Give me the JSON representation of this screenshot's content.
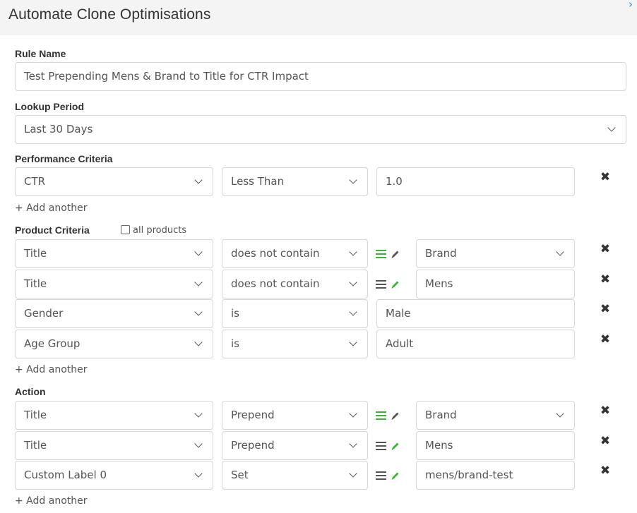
{
  "modal": {
    "title": "Automate Clone Optimisations",
    "close_glyph": "›"
  },
  "rule_name": {
    "label": "Rule Name",
    "value": "Test Prepending Mens & Brand to Title for CTR Impact"
  },
  "lookup_period": {
    "label": "Lookup Period",
    "value": "Last 30 Days"
  },
  "performance": {
    "label": "Performance Criteria",
    "rows": [
      {
        "field": "CTR",
        "operator": "Less Than",
        "value": "1.0"
      }
    ],
    "add_label": "+ Add another"
  },
  "product": {
    "label": "Product Criteria",
    "all_products_label": "all products",
    "rows": [
      {
        "field": "Title",
        "operator": "does not contain",
        "value": "Brand",
        "mode": "list"
      },
      {
        "field": "Title",
        "operator": "does not contain",
        "value": "Mens",
        "mode": "text"
      },
      {
        "field": "Gender",
        "operator": "is",
        "value": "Male"
      },
      {
        "field": "Age Group",
        "operator": "is",
        "value": "Adult"
      }
    ],
    "add_label": "+ Add another"
  },
  "action": {
    "label": "Action",
    "rows": [
      {
        "field": "Title",
        "operator": "Prepend",
        "value": "Brand",
        "mode": "list"
      },
      {
        "field": "Title",
        "operator": "Prepend",
        "value": "Mens",
        "mode": "text"
      },
      {
        "field": "Custom Label 0",
        "operator": "Set",
        "value": "mens/brand-test",
        "mode": "text"
      }
    ],
    "add_label": "+ Add another"
  },
  "icons": {
    "delete": "heavy-x-icon",
    "list_mode": "list-icon",
    "text_mode": "pencil-icon",
    "dropdown": "chevron-down-icon"
  },
  "colors": {
    "active_mode": "#3cb43c",
    "inactive_mode": "#555555",
    "close_link": "#3b82c4"
  }
}
